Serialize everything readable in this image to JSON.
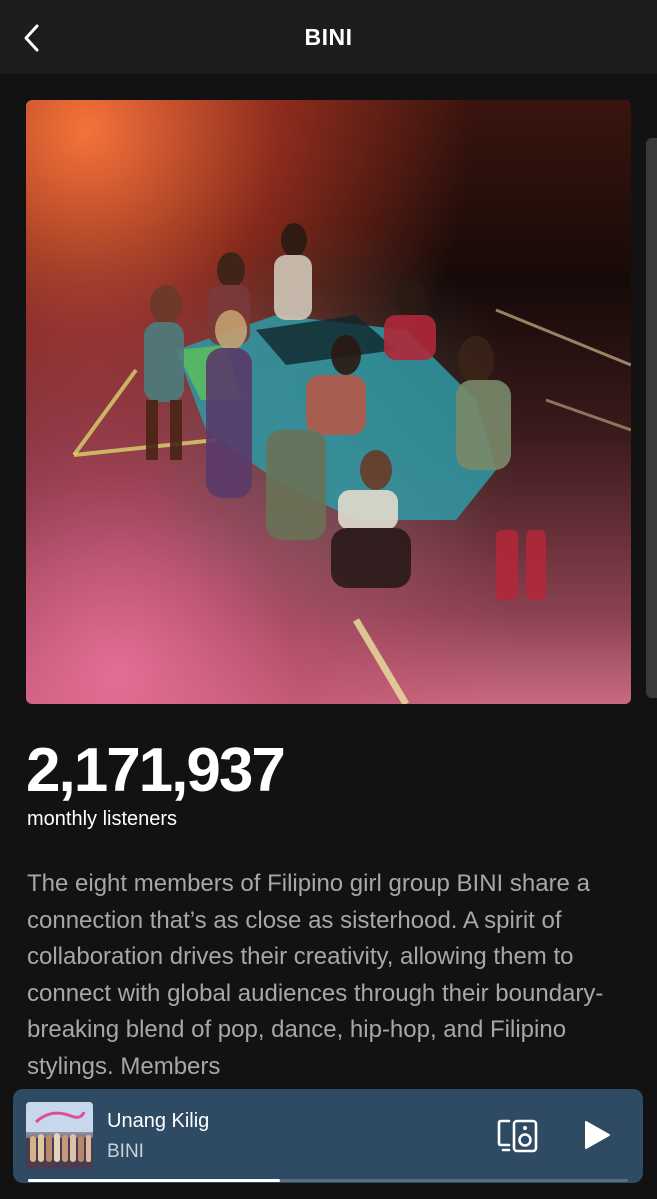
{
  "header": {
    "title": "BINI",
    "back_icon": "chevron-left-icon"
  },
  "artist": {
    "image_alt": "BINI artist photo",
    "monthly_listeners": "2,171,937",
    "monthly_listeners_label": "monthly listeners",
    "bio": "The eight members of Filipino girl group BINI share a connection that’s as close as sisterhood. A spirit of collaboration drives their creativity, allowing them to connect with global audiences through their boundary-breaking blend of pop, dance, hip-hop, and Filipino stylings. Members"
  },
  "now_playing": {
    "title": "Unang Kilig",
    "artist": "BINI",
    "device_icon": "connect-device-icon",
    "play_icon": "play-icon",
    "progress": 0.42
  },
  "colors": {
    "background": "#121212",
    "header": "#1d1d1d",
    "mini_player": "#2e4b63",
    "secondary_text": "#a7a7a7"
  }
}
